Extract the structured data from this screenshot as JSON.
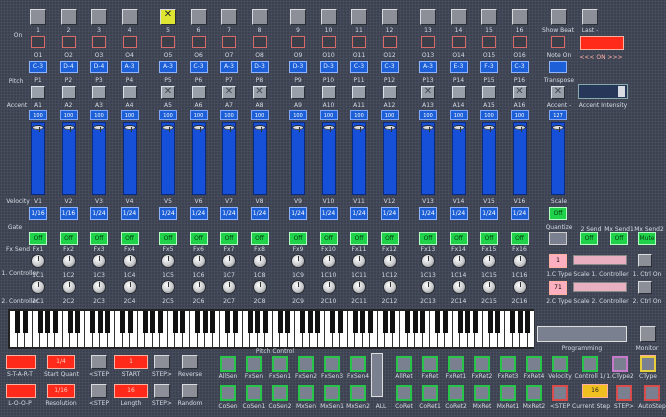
{
  "channels": [
    "1",
    "2",
    "3",
    "4",
    "5",
    "6",
    "7",
    "8",
    "9",
    "10",
    "11",
    "12",
    "13",
    "14",
    "15",
    "16"
  ],
  "step_on_labels": [
    "O1",
    "O2",
    "O3",
    "O4",
    "O5",
    "O6",
    "O7",
    "O8",
    "O9",
    "O10",
    "O11",
    "O12",
    "O13",
    "O14",
    "O15",
    "O16"
  ],
  "notes": [
    "C-3",
    "D-4",
    "D-4",
    "A-3",
    "A-3",
    "C-3",
    "A-3",
    "D-3",
    "D-3",
    "D-3",
    "C-3",
    "C-3",
    "A-3",
    "E-3",
    "F-3",
    "C-3"
  ],
  "pitch_labels": [
    "P1",
    "P2",
    "P3",
    "P4",
    "P5",
    "P6",
    "P7",
    "P8",
    "P9",
    "P10",
    "P11",
    "P12",
    "P13",
    "P14",
    "P15",
    "P16"
  ],
  "accent_labels": [
    "A1",
    "A2",
    "A3",
    "A4",
    "A5",
    "A6",
    "A7",
    "A8",
    "A9",
    "A10",
    "A11",
    "A12",
    "A13",
    "A14",
    "A15",
    "A16"
  ],
  "velocity_values": [
    "100",
    "100",
    "100",
    "100",
    "100",
    "100",
    "100",
    "100",
    "100",
    "100",
    "100",
    "100",
    "100",
    "100",
    "100",
    "100"
  ],
  "velocity_labels": [
    "V1",
    "V2",
    "V3",
    "V4",
    "V5",
    "V6",
    "V7",
    "V8",
    "V9",
    "V10",
    "V11",
    "V12",
    "V13",
    "V14",
    "V15",
    "V16"
  ],
  "lengths": [
    "1/16",
    "1/16",
    "1/24",
    "1/24",
    "1/24",
    "1/24",
    "1/24",
    "1/24",
    "1/24",
    "1/24",
    "1/24",
    "1/24",
    "1/24",
    "1/24",
    "1/24",
    "1/24"
  ],
  "gates": [
    "Off",
    "Off",
    "Off",
    "Off",
    "Off",
    "Off",
    "Off",
    "Off",
    "Off",
    "Off",
    "Off",
    "Off",
    "Off",
    "Off",
    "Off",
    "Off"
  ],
  "fx_labels": [
    "Fx1",
    "Fx2",
    "Fx3",
    "Fx4",
    "Fx5",
    "Fx6",
    "Fx7",
    "Fx8",
    "Fx9",
    "Fx10",
    "Fx11",
    "Fx12",
    "Fx13",
    "Fx14",
    "Fx15",
    "Fx16"
  ],
  "c1_labels": [
    "1C1",
    "1C2",
    "1C3",
    "1C4",
    "1C5",
    "1C6",
    "1C7",
    "1C8",
    "1C9",
    "1C10",
    "1C11",
    "1C12",
    "1C13",
    "1C14",
    "1C15",
    "1C16"
  ],
  "c2_labels": [
    "2C1",
    "2C2",
    "2C3",
    "2C4",
    "2C5",
    "2C6",
    "2C7",
    "2C8",
    "2C9",
    "2C10",
    "2C11",
    "2C12",
    "2C13",
    "2C14",
    "2C15",
    "2C16"
  ],
  "row_labels": {
    "on": "On",
    "pitch": "Pitch",
    "accent": "Accent",
    "velocity": "Velocity",
    "gate": "Gate",
    "fx_send": "Fx Send",
    "controller1": "1. Controller",
    "controller2": "2. Controller"
  },
  "right": {
    "show_beat": "Show Beat",
    "last": "Last -",
    "note_on": "Note On",
    "on_on": "<<< ON >>>",
    "transpose": "Transpose",
    "accent": "Accent -",
    "accent_intensity": "Accent Intensity",
    "scale_value": "127",
    "scale": "Scale",
    "scale_off": "Off",
    "quantize": "Quantize",
    "quant_labels": [
      "2 Send",
      "Mx Send1",
      "Mx Send2"
    ],
    "mute": "Mute",
    "send_value": "1",
    "c_type1": "1.C Type",
    "c_type2": "2.C Type",
    "ctype2_value": "71",
    "scale1": "Scale 1. Controller",
    "scale2": "Scale 2. Controller",
    "ctrl_on1": "1. Ctrl On",
    "ctrl_on2": "2. Ctrl On"
  },
  "bottom": {
    "start": "S-T-A-R-T",
    "loop": "L-O-O-P",
    "start_quant_value": "1/4",
    "start_quant": "Start Quant",
    "resolution_value": "1/16",
    "resolution": "Resolution",
    "step_back": "<STEP",
    "start_value": "1",
    "start_label": "START",
    "step_fwd": "STEP>",
    "length_value": "16",
    "length_label": "Length",
    "reverse": "Reverse",
    "random": "Random",
    "pitch_control": "Pitch Control",
    "top_row": [
      "AllSen",
      "FxSen",
      "FxSen1",
      "FxSen2",
      "FxSen3",
      "FxSen4",
      "AllRet",
      "FxRet",
      "FxRet1",
      "FxRet2",
      "FxRet3",
      "FxRet4",
      "Velocity",
      "Controll 1/",
      "1.CType2",
      "CType"
    ],
    "bottom_row": [
      "CoSen",
      "CoSen1",
      "CoSen2",
      "MxSen",
      "MxSen1",
      "MxSen2",
      "ALL",
      "CoRet",
      "CoRet1",
      "CoRet2",
      "MxRet",
      "MxRet1",
      "MxRet2",
      "<STEP",
      "Current Step",
      "STEP>",
      "AutoStep"
    ],
    "programming": "Programming",
    "monitor": "Monitor",
    "monitor_value": "71",
    "current_step_value": "16"
  }
}
